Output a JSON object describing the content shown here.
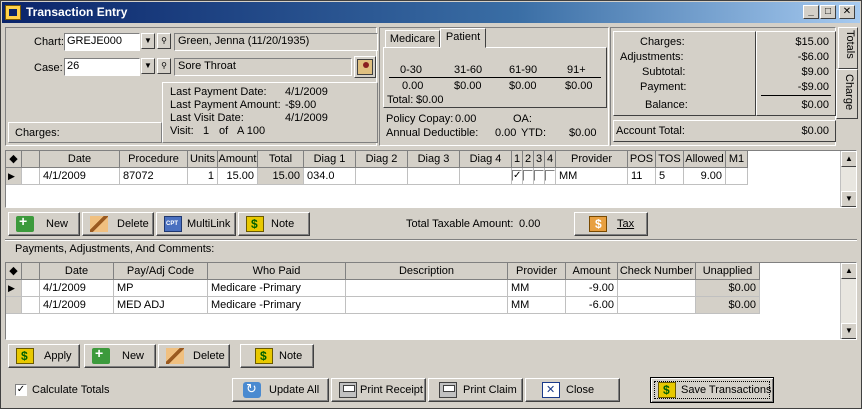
{
  "window": {
    "title": "Transaction Entry",
    "minimize": "_",
    "maximize": "□",
    "close": "✕"
  },
  "patient": {
    "chart_label": "Chart:",
    "chart_value": "GREJE000",
    "patient_name": "Green, Jenna  (11/20/1935)",
    "case_label": "Case:",
    "case_value": "26",
    "case_description": "Sore Throat",
    "charges_label": "Charges:"
  },
  "payment_info": {
    "last_payment_date_label": "Last Payment Date:",
    "last_payment_date": "4/1/2009",
    "last_payment_amount_label": "Last Payment Amount:",
    "last_payment_amount": "-$9.00",
    "last_visit_date_label": "Last Visit Date:",
    "last_visit_date": "4/1/2009",
    "visit_label": "Visit:",
    "visit_num": "1",
    "visit_of": "of",
    "visit_total": "A 100"
  },
  "aging": {
    "tabs": [
      "Medicare",
      "Patient"
    ],
    "active_tab": "Patient",
    "headers": [
      "0-30",
      "31-60",
      "61-90",
      "91+"
    ],
    "values": [
      "0.00",
      "$0.00",
      "$0.00",
      "$0.00"
    ],
    "total_label": "Total:",
    "total_value": "$0.00",
    "policy_copay_label": "Policy Copay:",
    "policy_copay": "0.00",
    "oa_label": "OA:",
    "annual_deductible_label": "Annual Deductible:",
    "annual_deductible": "0.00",
    "ytd_label": "YTD:",
    "ytd_value": "$0.00"
  },
  "totals": {
    "charges_label": "Charges:",
    "charges": "$15.00",
    "adjustments_label": "Adjustments:",
    "adjustments": "-$6.00",
    "subtotal_label": "Subtotal:",
    "subtotal": "$9.00",
    "payment_label": "Payment:",
    "payment": "-$9.00",
    "balance_label": "Balance:",
    "balance": "$0.00",
    "account_total_label": "Account Total:",
    "account_total": "$0.00"
  },
  "side_tabs": [
    "Totals",
    "Charge"
  ],
  "charges_grid": {
    "columns": [
      "Date",
      "Procedure",
      "Units",
      "Amount",
      "Total",
      "Diag 1",
      "Diag 2",
      "Diag 3",
      "Diag 4",
      "1",
      "2",
      "3",
      "4",
      "Provider",
      "POS",
      "TOS",
      "Allowed",
      "M1"
    ],
    "rows": [
      {
        "date": "4/1/2009",
        "procedure": "87072",
        "units": "1",
        "amount": "15.00",
        "total": "15.00",
        "diag1": "034.0",
        "check1": "✓",
        "provider": "MM",
        "pos": "11",
        "tos": "5",
        "allowed": "9.00"
      }
    ]
  },
  "charge_buttons": {
    "new": "New",
    "delete": "Delete",
    "multilink": "MultiLink",
    "note": "Note",
    "tax": "Tax"
  },
  "total_taxable_label": "Total Taxable Amount:",
  "total_taxable_value": "0.00",
  "payments_section_label": "Payments, Adjustments, And Comments:",
  "payments_grid": {
    "columns": [
      "Date",
      "Pay/Adj Code",
      "Who Paid",
      "Description",
      "Provider",
      "Amount",
      "Check Number",
      "Unapplied"
    ],
    "rows": [
      {
        "date": "4/1/2009",
        "code": "MP",
        "who_paid": "Medicare -Primary",
        "description": "",
        "provider": "MM",
        "amount": "-9.00",
        "check": "",
        "unapplied": "$0.00"
      },
      {
        "date": "4/1/2009",
        "code": "MED ADJ",
        "who_paid": "Medicare -Primary",
        "description": "",
        "provider": "MM",
        "amount": "-6.00",
        "check": "",
        "unapplied": "$0.00"
      }
    ]
  },
  "payment_buttons": {
    "apply": "Apply",
    "new": "New",
    "delete": "Delete",
    "note": "Note"
  },
  "footer": {
    "calculate_totals_label": "Calculate Totals",
    "calculate_totals_checked": "✓",
    "update_all": "Update All",
    "print_receipt": "Print Receipt",
    "print_claim": "Print Claim",
    "close": "Close",
    "save_transactions": "Save Transactions"
  }
}
